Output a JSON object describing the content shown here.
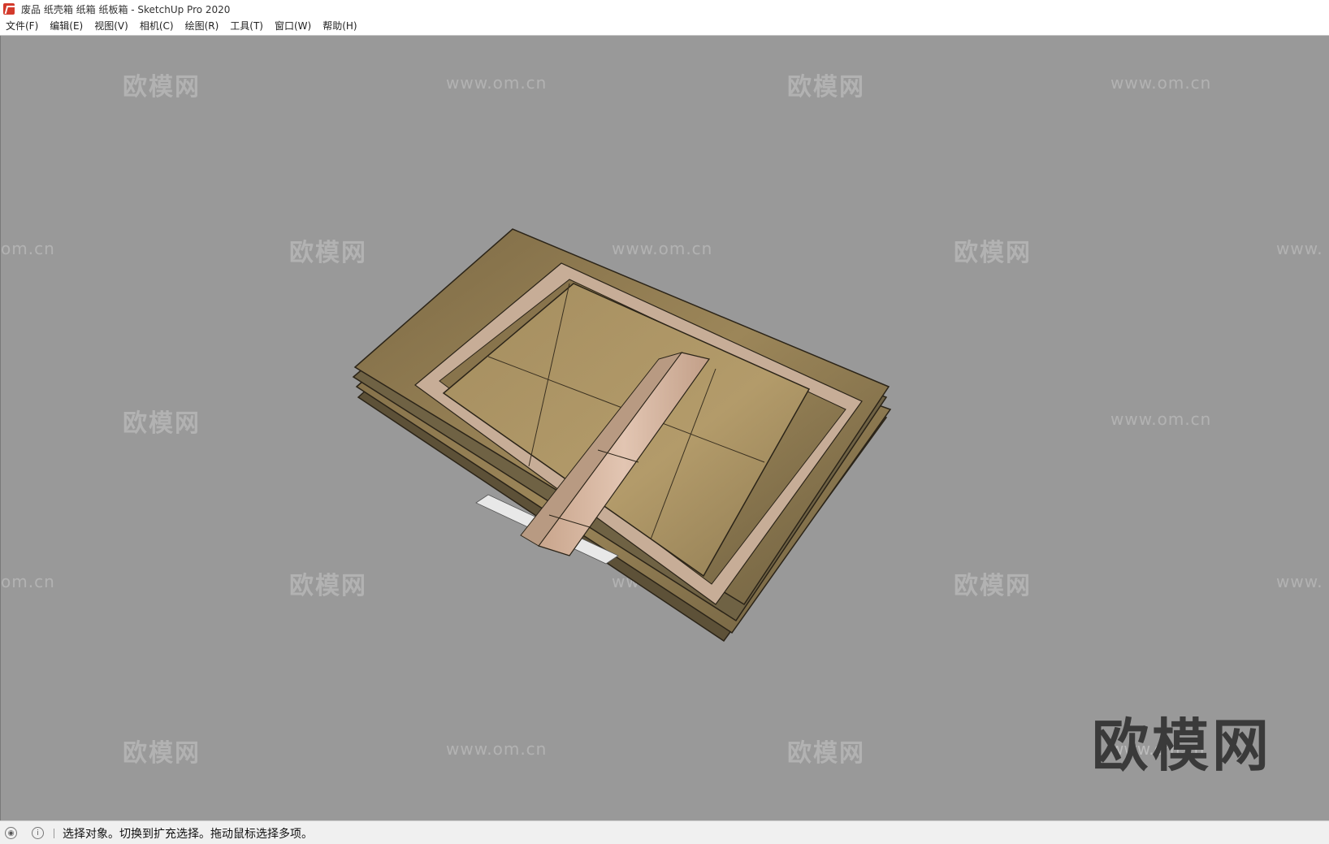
{
  "window": {
    "title": "废品 纸壳箱 纸箱 纸板箱 - SketchUp Pro 2020"
  },
  "menu": [
    {
      "label": "文件(F)"
    },
    {
      "label": "编辑(E)"
    },
    {
      "label": "视图(V)"
    },
    {
      "label": "相机(C)"
    },
    {
      "label": "绘图(R)"
    },
    {
      "label": "工具(T)"
    },
    {
      "label": "窗口(W)"
    },
    {
      "label": "帮助(H)"
    }
  ],
  "watermark": {
    "brand": "欧模网",
    "url": "www.om.cn",
    "url_left_cut": "om.cn",
    "url_right_cut": "www."
  },
  "statusbar": {
    "message": "选择对象。切换到扩充选择。拖动鼠标选择多项。",
    "icons": [
      "geo-location-icon",
      "info-icon"
    ]
  },
  "colors": {
    "viewport_bg": "#999999",
    "cardboard": "#8c7a55",
    "tape": "#d9b8a0"
  }
}
